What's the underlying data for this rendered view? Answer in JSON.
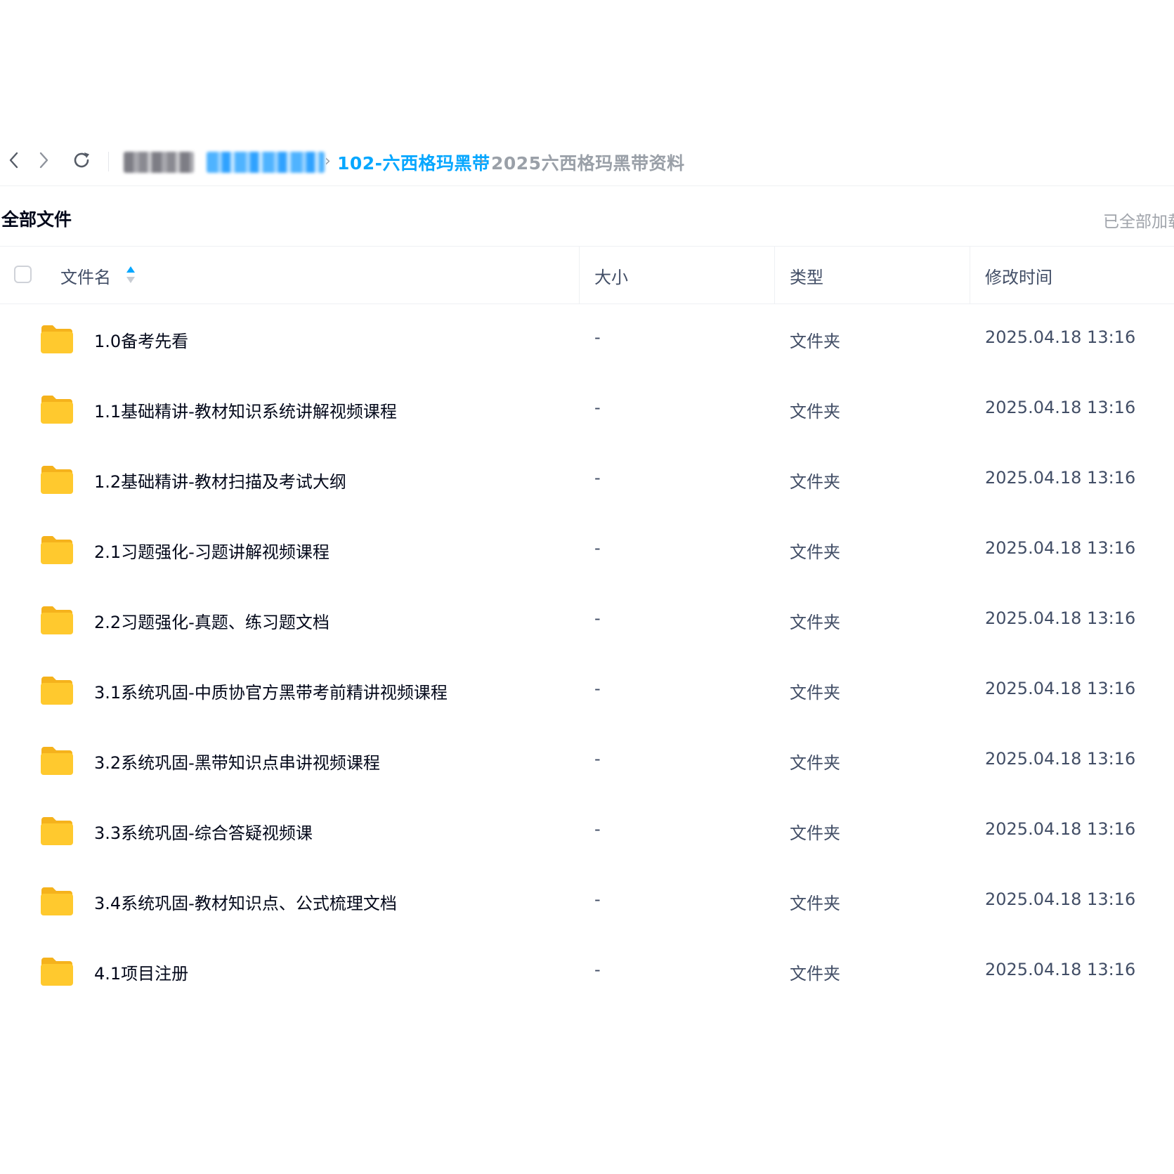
{
  "nav": {
    "back_icon": "chevron-left-icon",
    "forward_icon": "chevron-right-icon",
    "refresh_icon": "refresh-icon"
  },
  "breadcrumb": {
    "separator": "›",
    "link": "102-六西格玛黑带",
    "current": "2025六西格玛黑带资料"
  },
  "section": {
    "title": "全部文件",
    "status": "已全部加载"
  },
  "table": {
    "columns": {
      "name": "文件名",
      "size": "大小",
      "type": "类型",
      "modified": "修改时间"
    },
    "rows": [
      {
        "name": "1.0备考先看",
        "size": "-",
        "type": "文件夹",
        "modified": "2025.04.18 13:16"
      },
      {
        "name": "1.1基础精讲-教材知识系统讲解视频课程",
        "size": "-",
        "type": "文件夹",
        "modified": "2025.04.18 13:16"
      },
      {
        "name": "1.2基础精讲-教材扫描及考试大纲",
        "size": "-",
        "type": "文件夹",
        "modified": "2025.04.18 13:16"
      },
      {
        "name": "2.1习题强化-习题讲解视频课程",
        "size": "-",
        "type": "文件夹",
        "modified": "2025.04.18 13:16"
      },
      {
        "name": "2.2习题强化-真题、练习题文档",
        "size": "-",
        "type": "文件夹",
        "modified": "2025.04.18 13:16"
      },
      {
        "name": "3.1系统巩固-中质协官方黑带考前精讲视频课程",
        "size": "-",
        "type": "文件夹",
        "modified": "2025.04.18 13:16"
      },
      {
        "name": "3.2系统巩固-黑带知识点串讲视频课程",
        "size": "-",
        "type": "文件夹",
        "modified": "2025.04.18 13:16"
      },
      {
        "name": "3.3系统巩固-综合答疑视频课",
        "size": "-",
        "type": "文件夹",
        "modified": "2025.04.18 13:16"
      },
      {
        "name": "3.4系统巩固-教材知识点、公式梳理文档",
        "size": "-",
        "type": "文件夹",
        "modified": "2025.04.18 13:16"
      },
      {
        "name": "4.1项目注册",
        "size": "-",
        "type": "文件夹",
        "modified": "2025.04.18 13:16"
      }
    ]
  },
  "colors": {
    "accent": "#06a7ff",
    "folder": "#ffc92e",
    "folder_tab": "#f5b21c",
    "muted": "#9aa0a8"
  }
}
